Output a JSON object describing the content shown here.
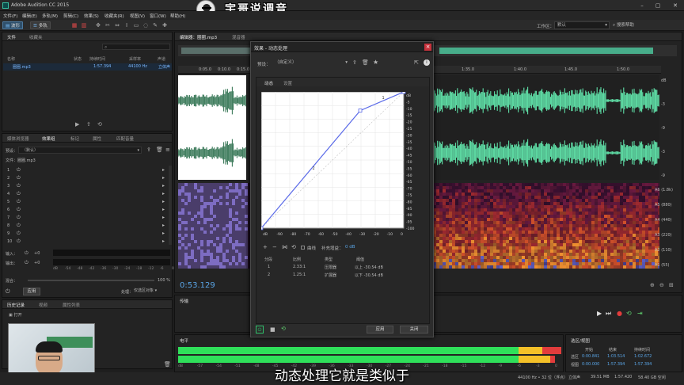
{
  "app": {
    "title": "Adobe Audition CC 2015",
    "logo_text": "宇哥说调音",
    "workspace_label": "工作区：",
    "workspace_value": "默认",
    "search_help": "搜索帮助"
  },
  "menu": [
    "文件(F)",
    "编辑(E)",
    "多轨(M)",
    "剪辑(C)",
    "效果(S)",
    "收藏夹(R)",
    "视图(V)",
    "窗口(W)",
    "帮助(H)"
  ],
  "toolbar": {
    "waveform": "波形",
    "multitrack": "多轨"
  },
  "files_panel": {
    "tabs": [
      "文件",
      "收藏夹"
    ],
    "columns": [
      "名称",
      "状态",
      "持续时间",
      "采样率",
      "声道"
    ],
    "row": {
      "name": "圈圈.mp3",
      "duration": "1:57.394",
      "rate": "44100 Hz",
      "channels": "立体声"
    }
  },
  "effects_rack": {
    "tabs": [
      "媒体浏览器",
      "效果组",
      "标记",
      "属性",
      "匹配音量"
    ],
    "preset_label": "预设：",
    "preset_value": "（默认）",
    "file_label": "文件：圈圈.mp3",
    "slots": [
      "1",
      "2",
      "3",
      "4",
      "5",
      "6",
      "7",
      "8",
      "9",
      "10"
    ],
    "input_label": "输入：",
    "output_label": "输出：",
    "mix_label": "混合：",
    "mix_value": "100 %",
    "meter_ticks": [
      "dB",
      "-54",
      "-48",
      "-42",
      "-36",
      "-30",
      "-24",
      "-18",
      "-12",
      "-6",
      "0"
    ],
    "apply": "应用",
    "process_label": "处理：",
    "process_value": "仅选区对象"
  },
  "history": {
    "tabs": [
      "历史记录",
      "视频",
      "属性列表"
    ],
    "item": "打开"
  },
  "editor": {
    "tab": "编辑器：圈圈.mp3",
    "mixer_tab": "混音器",
    "time": "0:53.129",
    "ruler": [
      "0:05.0",
      "0:10.0",
      "0:15.0",
      "1:35.0",
      "1:40.0",
      "1:45.0",
      "1:50.0"
    ],
    "freq_labels": [
      "A6 (1.8k)",
      "A5 (880)",
      "A4 (440)",
      "A3 (220)",
      "A2 (110)",
      "A1 (55)"
    ],
    "db_side": [
      "dB",
      "-3",
      "-9",
      "-3",
      "-9"
    ]
  },
  "dialog": {
    "title": "效果 - 动态处理",
    "preset_label": "预设：",
    "preset_value": "（自定义）",
    "tabs": [
      "动态",
      "设置"
    ],
    "y_ticks": [
      "dB",
      "-5",
      "-10",
      "-15",
      "-20",
      "-25",
      "-30",
      "-35",
      "-40",
      "-45",
      "-50",
      "-55",
      "-60",
      "-65",
      "-70",
      "-75",
      "-80",
      "-85",
      "-90",
      "-95",
      "-100"
    ],
    "x_ticks": [
      "dB",
      "-90",
      "-80",
      "-70",
      "-60",
      "-50",
      "-40",
      "-30",
      "-20",
      "-10",
      "0"
    ],
    "curve_points": [
      {
        "x": -100,
        "y": -100
      },
      {
        "x": -30.54,
        "y": -13.7
      },
      {
        "x": 0,
        "y": 0
      }
    ],
    "point_labels": [
      "1",
      "2"
    ],
    "curve_label": "曲线",
    "makeup_label": "补充增益：",
    "makeup_value": "0 dB",
    "table_columns": [
      "分段",
      "比例",
      "类型",
      "阈值"
    ],
    "table_rows": [
      {
        "seg": "1",
        "ratio": "2.33:1",
        "type": "压限器",
        "threshold": "以上 -30.54 dB"
      },
      {
        "seg": "2",
        "ratio": "1.25:1",
        "type": "扩展器",
        "threshold": "以下 -30.54 dB"
      }
    ],
    "apply": "应用",
    "close": "关闭"
  },
  "transport": {
    "panel": "传输"
  },
  "levels": {
    "panel": "电平",
    "ticks": [
      "dB",
      "-57",
      "-54",
      "-51",
      "-48",
      "-45",
      "-42",
      "-39",
      "-36",
      "-33",
      "-30",
      "-27",
      "-24",
      "-21",
      "-18",
      "-15",
      "-12",
      "-9",
      "-6",
      "-3",
      "0"
    ]
  },
  "selection": {
    "panel": "选区/视图",
    "columns": [
      "开始",
      "结束",
      "持续时间"
    ],
    "rows": [
      {
        "label": "选区",
        "start": "0:00.841",
        "end": "1:03.514",
        "dur": "1:02.672"
      },
      {
        "label": "视图",
        "start": "0:00.000",
        "end": "1:57.394",
        "dur": "1:57.394"
      }
    ]
  },
  "status": {
    "info": "44100 Hz • 32 位（浮点）",
    "stereo": "立体声",
    "size": "39.51 MB",
    "time": "1:57.420",
    "free": "58.40 GB 空闲"
  },
  "subtitle": "动态处理它就是类似于"
}
